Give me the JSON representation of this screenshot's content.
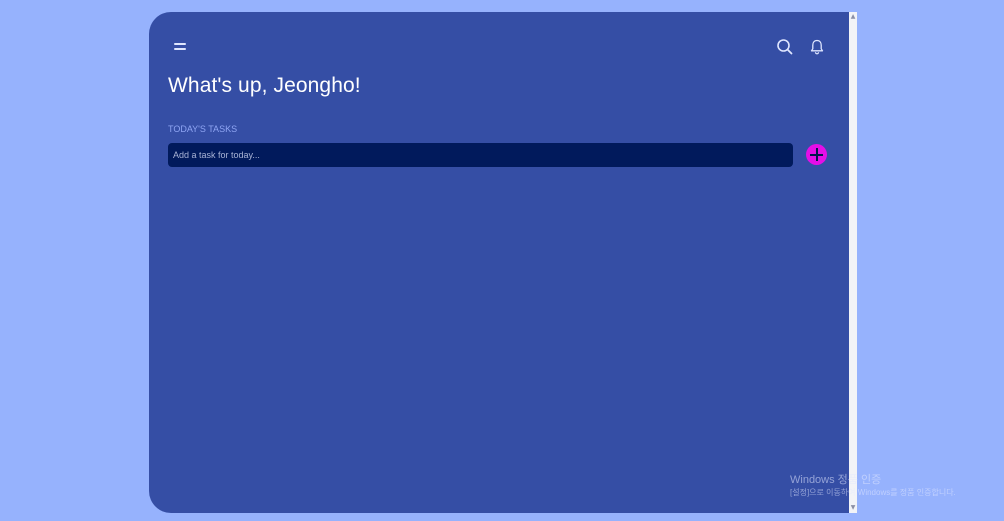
{
  "header": {
    "menu_icon": "menu-icon",
    "search_icon": "search-icon",
    "bell_icon": "bell-icon"
  },
  "greeting": "What's up, Jeongho!",
  "tasks": {
    "section_label": "TODAY'S TASKS",
    "input_placeholder": "Add a task for today...",
    "input_value": "",
    "add_icon": "plus-icon"
  },
  "watermark": {
    "title": "Windows 정품 인증",
    "subtitle": "[설정]으로 이동하여 Windows를 정품 인증합니다."
  },
  "colors": {
    "page_background": "#96b2fd",
    "app_background": "#354ea5",
    "input_background": "#011a5c",
    "accent": "#e40fe7",
    "section_label": "#8fa5f3"
  }
}
